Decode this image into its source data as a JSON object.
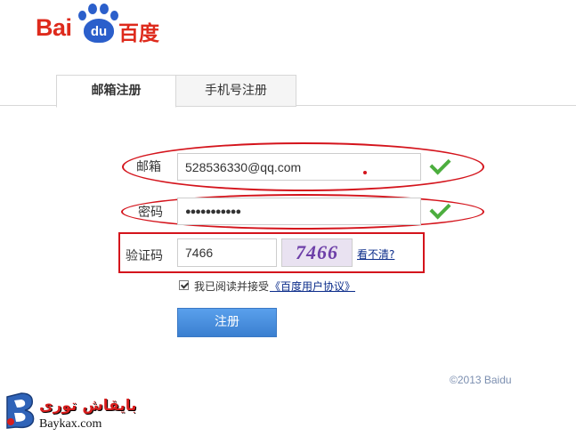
{
  "logo": {
    "text_latin": "Bai",
    "text_paw": "du",
    "text_cn": "百度",
    "brand_red": "#de2a1c",
    "brand_blue": "#2b5fcb"
  },
  "tabs": [
    {
      "label": "邮箱注册",
      "active": true
    },
    {
      "label": "手机号注册",
      "active": false
    }
  ],
  "form": {
    "email": {
      "label": "邮箱",
      "value": "528536330@qq.com",
      "valid": true
    },
    "password": {
      "label": "密码",
      "value": "●●●●●●●●●●●",
      "valid": true
    },
    "captcha": {
      "label": "验证码",
      "value": "7466",
      "image_text": "7466",
      "refresh_link": "看不清?"
    },
    "agreement": {
      "checked": true,
      "text": "我已阅读并接受",
      "link": "《百度用户协议》"
    },
    "submit_label": "注册"
  },
  "footer": {
    "copyright": "©2013 Baidu"
  },
  "watermark": {
    "arabic": "بایقاش توری",
    "site": "Baykax.com"
  },
  "colors": {
    "annotation_red": "#d4141c",
    "check_green": "#4cae3e",
    "button_blue": "#4a90e2"
  }
}
